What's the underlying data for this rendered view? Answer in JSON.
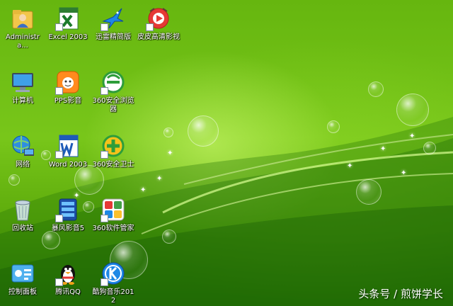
{
  "desktop": {
    "watermark": "头条号 / 煎饼学长",
    "icons": [
      {
        "label": "Administra...",
        "icon": "user-folder-icon",
        "shortcut": false
      },
      {
        "label": "Excel 2003",
        "icon": "excel-icon",
        "shortcut": true
      },
      {
        "label": "迅雷精简版",
        "icon": "thunder-bird-icon",
        "shortcut": true
      },
      {
        "label": "皮皮高清影视",
        "icon": "pipi-video-icon",
        "shortcut": true
      },
      {
        "label": "计算机",
        "icon": "computer-icon",
        "shortcut": false
      },
      {
        "label": "PPS影音",
        "icon": "pps-icon",
        "shortcut": true
      },
      {
        "label": "360安全浏览器",
        "icon": "360-browser-icon",
        "shortcut": true
      },
      {
        "label": "网络",
        "icon": "network-icon",
        "shortcut": false
      },
      {
        "label": "Word 2003",
        "icon": "word-icon",
        "shortcut": true
      },
      {
        "label": "360安全卫士",
        "icon": "360-safeguard-icon",
        "shortcut": true
      },
      {
        "label": "回收站",
        "icon": "recycle-bin-icon",
        "shortcut": false
      },
      {
        "label": "暴风影音5",
        "icon": "baofeng-icon",
        "shortcut": true
      },
      {
        "label": "360软件管家",
        "icon": "360-software-icon",
        "shortcut": true
      },
      {
        "label": "控制面板",
        "icon": "control-panel-icon",
        "shortcut": false
      },
      {
        "label": "腾讯QQ",
        "icon": "qq-penguin-icon",
        "shortcut": true
      },
      {
        "label": "酷狗音乐2012",
        "icon": "kugou-icon",
        "shortcut": true
      }
    ]
  }
}
